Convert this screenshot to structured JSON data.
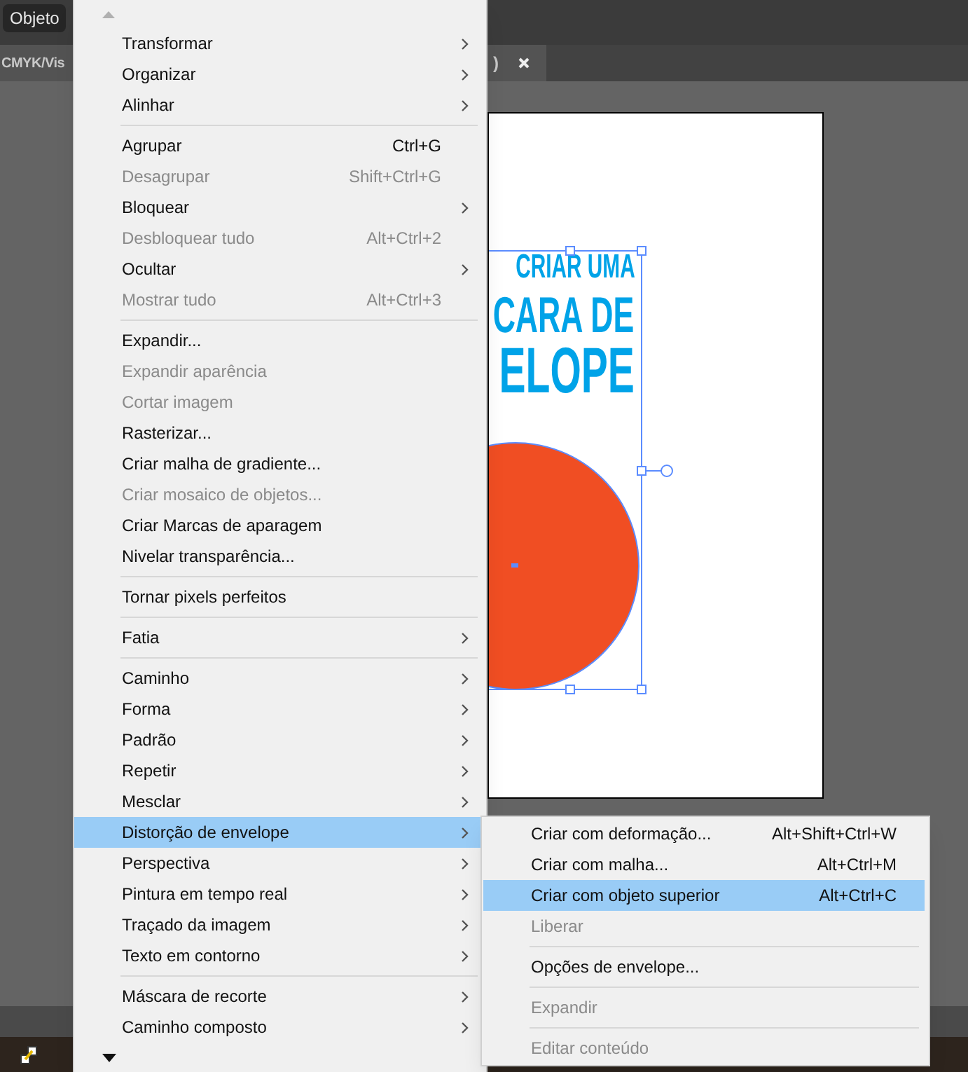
{
  "menubar": {
    "items": [
      {
        "label": "Objeto",
        "selected": true
      }
    ]
  },
  "document_tabs": [
    {
      "label": "CMYK/Vis"
    },
    {
      "label": ")"
    }
  ],
  "artboard": {
    "text_lines": [
      "CRIAR UMA",
      "CARA DE",
      "ELOPE"
    ]
  },
  "menu": {
    "items": [
      {
        "kind": "item",
        "label": "Transformar",
        "submenu": true,
        "disabled": false,
        "selected": false
      },
      {
        "kind": "item",
        "label": "Organizar",
        "submenu": true,
        "disabled": false,
        "selected": false
      },
      {
        "kind": "item",
        "label": "Alinhar",
        "submenu": true,
        "disabled": false,
        "selected": false
      },
      {
        "kind": "separator"
      },
      {
        "kind": "item",
        "label": "Agrupar",
        "shortcut": "Ctrl+G",
        "submenu": false,
        "disabled": false,
        "selected": false
      },
      {
        "kind": "item",
        "label": "Desagrupar",
        "shortcut": "Shift+Ctrl+G",
        "submenu": false,
        "disabled": true,
        "selected": false
      },
      {
        "kind": "item",
        "label": "Bloquear",
        "submenu": true,
        "disabled": false,
        "selected": false
      },
      {
        "kind": "item",
        "label": "Desbloquear tudo",
        "shortcut": "Alt+Ctrl+2",
        "submenu": false,
        "disabled": true,
        "selected": false
      },
      {
        "kind": "item",
        "label": "Ocultar",
        "submenu": true,
        "disabled": false,
        "selected": false
      },
      {
        "kind": "item",
        "label": "Mostrar tudo",
        "shortcut": "Alt+Ctrl+3",
        "submenu": false,
        "disabled": true,
        "selected": false
      },
      {
        "kind": "separator"
      },
      {
        "kind": "item",
        "label": "Expandir...",
        "submenu": false,
        "disabled": false,
        "selected": false
      },
      {
        "kind": "item",
        "label": "Expandir aparência",
        "submenu": false,
        "disabled": true,
        "selected": false
      },
      {
        "kind": "item",
        "label": "Cortar imagem",
        "submenu": false,
        "disabled": true,
        "selected": false
      },
      {
        "kind": "item",
        "label": "Rasterizar...",
        "submenu": false,
        "disabled": false,
        "selected": false
      },
      {
        "kind": "item",
        "label": "Criar malha de gradiente...",
        "submenu": false,
        "disabled": false,
        "selected": false
      },
      {
        "kind": "item",
        "label": "Criar mosaico de objetos...",
        "submenu": false,
        "disabled": true,
        "selected": false
      },
      {
        "kind": "item",
        "label": "Criar Marcas de aparagem",
        "submenu": false,
        "disabled": false,
        "selected": false
      },
      {
        "kind": "item",
        "label": "Nivelar transparência...",
        "submenu": false,
        "disabled": false,
        "selected": false
      },
      {
        "kind": "separator"
      },
      {
        "kind": "item",
        "label": "Tornar pixels perfeitos",
        "submenu": false,
        "disabled": false,
        "selected": false
      },
      {
        "kind": "separator"
      },
      {
        "kind": "item",
        "label": "Fatia",
        "submenu": true,
        "disabled": false,
        "selected": false
      },
      {
        "kind": "separator"
      },
      {
        "kind": "item",
        "label": "Caminho",
        "submenu": true,
        "disabled": false,
        "selected": false
      },
      {
        "kind": "item",
        "label": "Forma",
        "submenu": true,
        "disabled": false,
        "selected": false
      },
      {
        "kind": "item",
        "label": "Padrão",
        "submenu": true,
        "disabled": false,
        "selected": false
      },
      {
        "kind": "item",
        "label": "Repetir",
        "submenu": true,
        "disabled": false,
        "selected": false
      },
      {
        "kind": "item",
        "label": "Mesclar",
        "submenu": true,
        "disabled": false,
        "selected": false
      },
      {
        "kind": "item",
        "label": "Distorção de envelope",
        "submenu": true,
        "disabled": false,
        "selected": true
      },
      {
        "kind": "item",
        "label": "Perspectiva",
        "submenu": true,
        "disabled": false,
        "selected": false
      },
      {
        "kind": "item",
        "label": "Pintura em tempo real",
        "submenu": true,
        "disabled": false,
        "selected": false
      },
      {
        "kind": "item",
        "label": "Traçado da imagem",
        "submenu": true,
        "disabled": false,
        "selected": false
      },
      {
        "kind": "item",
        "label": "Texto em contorno",
        "submenu": true,
        "disabled": false,
        "selected": false
      },
      {
        "kind": "separator"
      },
      {
        "kind": "item",
        "label": "Máscara de recorte",
        "submenu": true,
        "disabled": false,
        "selected": false
      },
      {
        "kind": "item",
        "label": "Caminho composto",
        "submenu": true,
        "disabled": false,
        "selected": false
      }
    ]
  },
  "submenu": {
    "items": [
      {
        "kind": "item",
        "label": "Criar com deformação...",
        "shortcut": "Alt+Shift+Ctrl+W",
        "disabled": false,
        "selected": false
      },
      {
        "kind": "item",
        "label": "Criar com malha...",
        "shortcut": "Alt+Ctrl+M",
        "disabled": false,
        "selected": false
      },
      {
        "kind": "item",
        "label": "Criar com objeto superior",
        "shortcut": "Alt+Ctrl+C",
        "disabled": false,
        "selected": true
      },
      {
        "kind": "item",
        "label": "Liberar",
        "disabled": true,
        "selected": false
      },
      {
        "kind": "separator"
      },
      {
        "kind": "item",
        "label": "Opções de envelope...",
        "disabled": false,
        "selected": false
      },
      {
        "kind": "separator"
      },
      {
        "kind": "item",
        "label": "Expandir",
        "disabled": true,
        "selected": false
      },
      {
        "kind": "separator"
      },
      {
        "kind": "item",
        "label": "Editar conteúdo",
        "disabled": true,
        "selected": false
      }
    ]
  }
}
